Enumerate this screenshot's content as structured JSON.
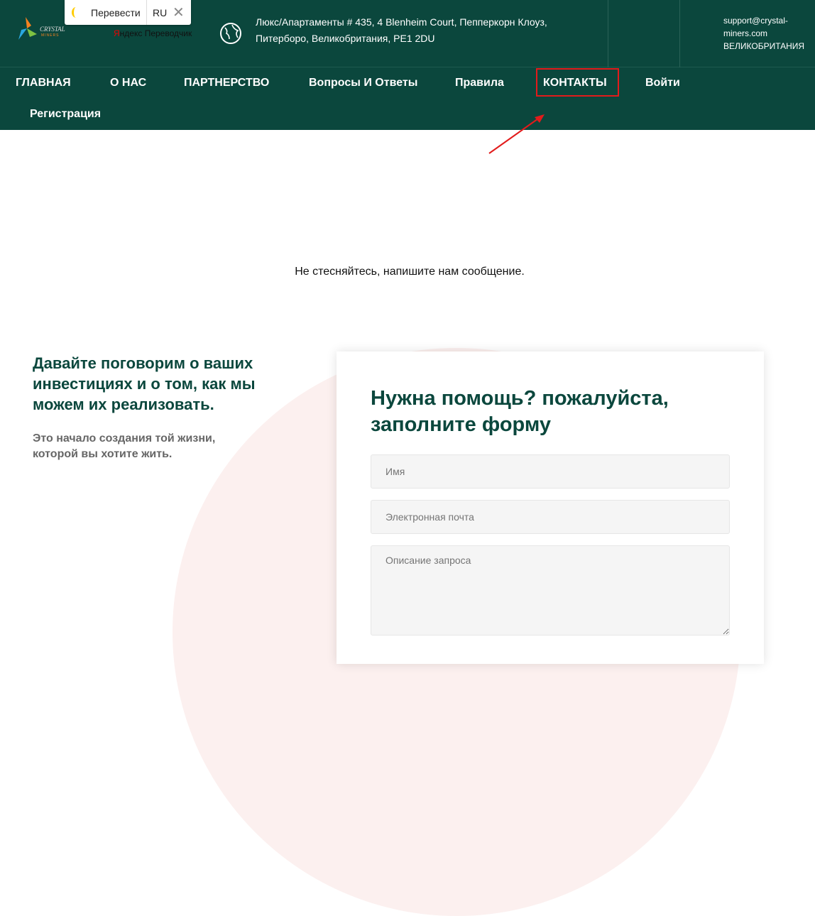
{
  "translate_bar": {
    "translate_label": "Перевести",
    "lang": "RU",
    "provider_prefix": "Я",
    "provider_rest": "ндекс Переводчик"
  },
  "logo": {
    "line1": "CRYSTAL",
    "line2": "MINERS"
  },
  "header": {
    "address_line1": "Люкс/Апартаменты # 435, 4 Blenheim Court, Пепперкорн Клоуз,",
    "address_line2": "Питерборо, Великобритания, PE1 2DU",
    "email_line1": "support@crystal-",
    "email_line2": "miners.com",
    "country": "ВЕЛИКОБРИТАНИЯ"
  },
  "nav": [
    "ГЛАВНАЯ",
    "О НАС",
    "ПАРТНЕРСТВО",
    "Вопросы И Ответы",
    "Правила",
    "КОНТАКТЫ",
    "Войти",
    "Регистрация"
  ],
  "main": {
    "message": "Не стесняйтесь, напишите нам сообщение.",
    "left_heading": "Давайте поговорим о ваших инвестициях и о том, как мы можем их реализовать.",
    "left_sub": "Это начало создания той жизни, которой вы хотите жить."
  },
  "form": {
    "title": "Нужна помощь? пожалуйста, заполните форму",
    "name_placeholder": "Имя",
    "email_placeholder": "Электронная почта",
    "desc_placeholder": "Описание запроса"
  }
}
